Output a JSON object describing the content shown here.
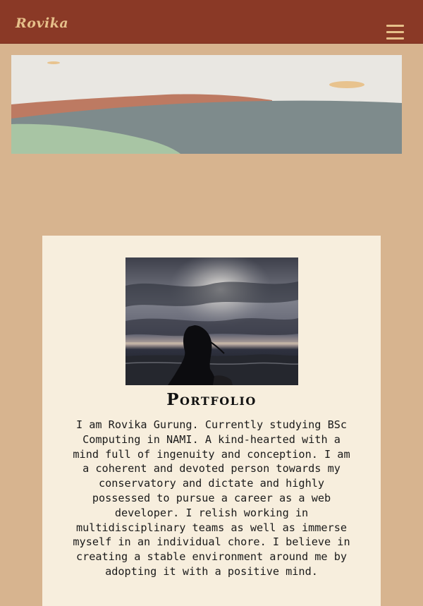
{
  "navbar": {
    "brand": "Rovika",
    "menu_icon": "hamburger-menu-icon"
  },
  "banner": {
    "image": "landscape-illustration"
  },
  "profile": {
    "photo": "person-on-beach-at-sunset-photo",
    "title": "Portfolio",
    "bio": "I am Rovika Gurung. Currently studying BSc Computing in NAMI. A kind-hearted with a mind full of ingenuity and conception. I am a coherent and devoted person towards my conservatory and dictate and highly possessed to pursue a career as a web developer. I relish working in multidisciplinary teams as well as immerse myself in an individual chore. I believe in creating a stable environment around me by adopting it with a positive mind."
  },
  "colors": {
    "background": "#d7b48f",
    "navbar": "#8a3926",
    "brand_text": "#e6c08a",
    "card": "#f7eedd"
  }
}
